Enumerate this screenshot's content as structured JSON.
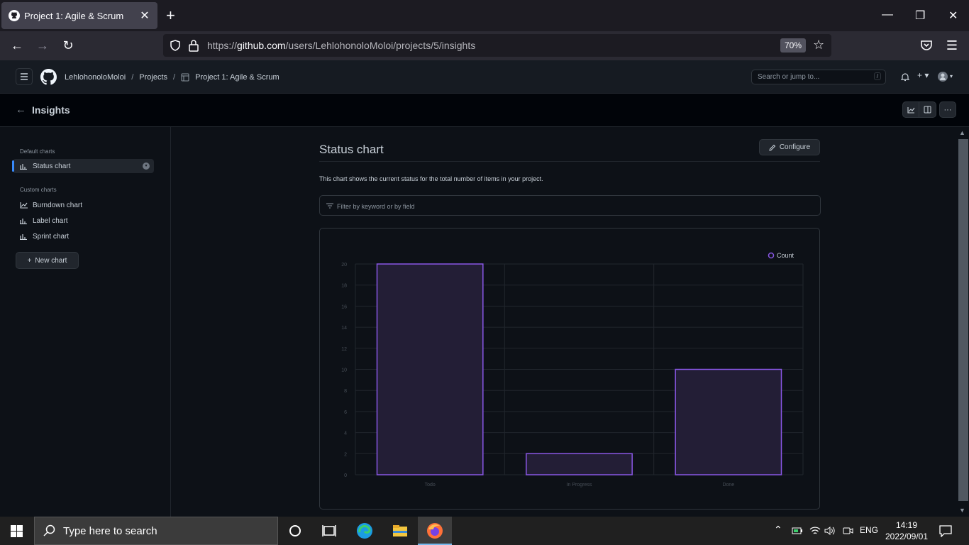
{
  "browser": {
    "tab_title": "Project 1: Agile & Scrum",
    "url_scheme": "https://",
    "url_host": "github.com",
    "url_path": "/users/LehlohonoloMoloi/projects/5/insights",
    "zoom": "70%"
  },
  "header": {
    "user": "LehlohonoloMoloi",
    "projects": "Projects",
    "project": "Project 1: Agile & Scrum",
    "search_placeholder": "Search or jump to...",
    "search_key": "/"
  },
  "insights": {
    "title": "Insights"
  },
  "sidebar": {
    "default_label": "Default charts",
    "default_items": [
      {
        "label": "Status chart"
      }
    ],
    "custom_label": "Custom charts",
    "custom_items": [
      {
        "label": "Burndown chart"
      },
      {
        "label": "Label chart"
      },
      {
        "label": "Sprint chart"
      }
    ],
    "new_chart": "New chart"
  },
  "main": {
    "title": "Status chart",
    "configure": "Configure",
    "description": "This chart shows the current status for the total number of items in your project.",
    "filter_placeholder": "Filter by keyword or by field"
  },
  "chart_data": {
    "type": "bar",
    "categories": [
      "Todo",
      "In Progress",
      "Done"
    ],
    "series": [
      {
        "name": "Count",
        "values": [
          20,
          2,
          10
        ]
      }
    ],
    "ylim": [
      0,
      20
    ],
    "yticks": [
      0,
      2,
      4,
      6,
      8,
      10,
      12,
      14,
      16,
      18,
      20
    ],
    "legend": "top-right",
    "grid": true,
    "colors": {
      "bar_fill": "#231e36",
      "bar_stroke": "#8957e5",
      "grid": "#21262d",
      "tick": "#484f58"
    }
  },
  "taskbar": {
    "search_placeholder": "Type here to search",
    "lang": "ENG",
    "time": "14:19",
    "date": "2022/09/01"
  }
}
